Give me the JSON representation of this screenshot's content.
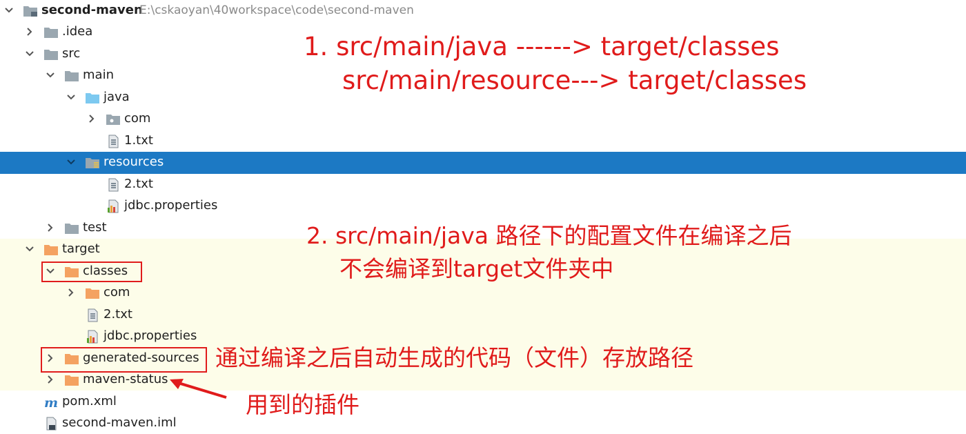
{
  "tree": {
    "root": {
      "name": "second-maven",
      "path": "E:\\cskaoyan\\40workspace\\code\\second-maven"
    },
    "items": [
      {
        "label": ".idea",
        "icon": "folder-icon"
      },
      {
        "label": "src",
        "icon": "folder-icon"
      },
      {
        "label": "main",
        "icon": "folder-icon"
      },
      {
        "label": "java",
        "icon": "source-folder-icon"
      },
      {
        "label": "com",
        "icon": "package-icon"
      },
      {
        "label": "1.txt",
        "icon": "text-file-icon"
      },
      {
        "label": "resources",
        "icon": "resources-folder-icon"
      },
      {
        "label": "2.txt",
        "icon": "text-file-icon"
      },
      {
        "label": "jdbc.properties",
        "icon": "properties-file-icon"
      },
      {
        "label": "test",
        "icon": "folder-icon"
      },
      {
        "label": "target",
        "icon": "excluded-folder-icon"
      },
      {
        "label": "classes",
        "icon": "excluded-folder-icon"
      },
      {
        "label": "com",
        "icon": "excluded-folder-icon"
      },
      {
        "label": "2.txt",
        "icon": "text-file-icon"
      },
      {
        "label": "jdbc.properties",
        "icon": "properties-file-icon"
      },
      {
        "label": "generated-sources",
        "icon": "excluded-folder-icon"
      },
      {
        "label": "maven-status",
        "icon": "excluded-folder-icon"
      },
      {
        "label": "pom.xml",
        "icon": "maven-icon"
      },
      {
        "label": "second-maven.iml",
        "icon": "module-file-icon"
      }
    ]
  },
  "annotations": {
    "note1_line1": "1.  src/main/java    ------> target/classes",
    "note1_line2": "src/main/resource---> target/classes",
    "note2_line1": "2. src/main/java 路径下的配置文件在编译之后",
    "note2_line2": "不会编译到target文件夹中",
    "note3": "通过编译之后自动生成的代码（文件）存放路径",
    "note4": "用到的插件"
  },
  "colors": {
    "selection": "#1c79c4",
    "target_band": "#fdfde9",
    "annotation_red": "#e01b1b",
    "folder_gray": "#9aa7b0",
    "folder_orange": "#f4a261",
    "source_blue": "#7dc9f0"
  }
}
